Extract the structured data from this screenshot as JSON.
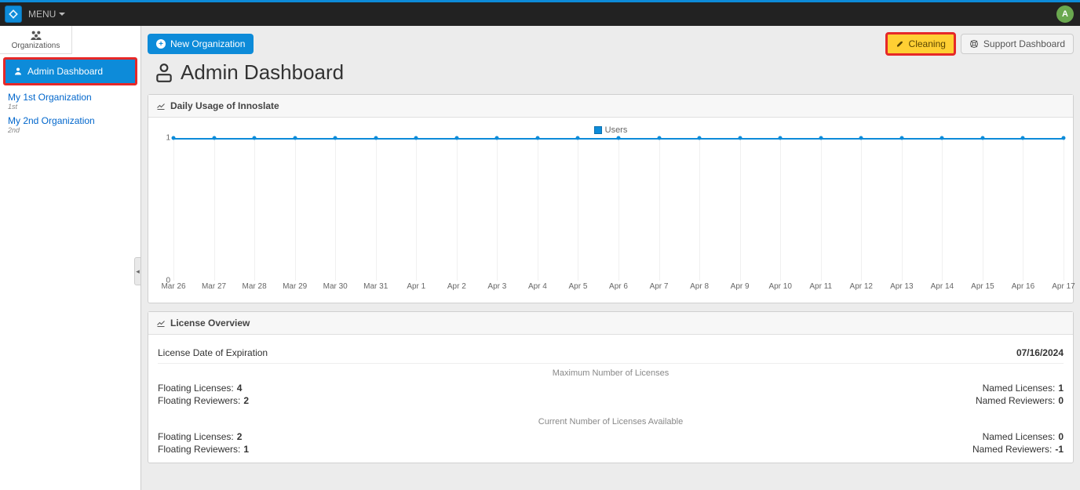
{
  "navbar": {
    "menu_label": "MENU",
    "avatar_initial": "A"
  },
  "sidebar": {
    "tab_label": "Organizations",
    "admin_label": "Admin Dashboard",
    "orgs": [
      {
        "name": "My 1st Organization",
        "sub": "1st"
      },
      {
        "name": "My 2nd Organization",
        "sub": "2nd"
      }
    ]
  },
  "toolbar": {
    "new_org_label": "New Organization",
    "cleaning_label": "Cleaning",
    "support_label": "Support Dashboard"
  },
  "page": {
    "title": "Admin Dashboard"
  },
  "usage_panel": {
    "title": "Daily Usage of Innoslate",
    "legend_label": "Users"
  },
  "license_panel": {
    "title": "License Overview",
    "expiration_label": "License Date of Expiration",
    "expiration_value": "07/16/2024",
    "max_note": "Maximum Number of Licenses",
    "avail_note": "Current Number of Licenses Available",
    "max": {
      "floating_licenses_label": "Floating Licenses:",
      "floating_licenses_value": "4",
      "floating_reviewers_label": "Floating Reviewers:",
      "floating_reviewers_value": "2",
      "named_licenses_label": "Named Licenses:",
      "named_licenses_value": "1",
      "named_reviewers_label": "Named Reviewers:",
      "named_reviewers_value": "0"
    },
    "avail": {
      "floating_licenses_label": "Floating Licenses:",
      "floating_licenses_value": "2",
      "floating_reviewers_label": "Floating Reviewers:",
      "floating_reviewers_value": "1",
      "named_licenses_label": "Named Licenses:",
      "named_licenses_value": "0",
      "named_reviewers_label": "Named Reviewers:",
      "named_reviewers_value": "-1"
    }
  },
  "chart_data": {
    "type": "line",
    "title": "Daily Usage of Innoslate",
    "xlabel": "",
    "ylabel": "",
    "ylim": [
      0,
      1
    ],
    "yticks": [
      0,
      1
    ],
    "categories": [
      "Mar 26",
      "Mar 27",
      "Mar 28",
      "Mar 29",
      "Mar 30",
      "Mar 31",
      "Apr 1",
      "Apr 2",
      "Apr 3",
      "Apr 4",
      "Apr 5",
      "Apr 6",
      "Apr 7",
      "Apr 8",
      "Apr 9",
      "Apr 10",
      "Apr 11",
      "Apr 12",
      "Apr 13",
      "Apr 14",
      "Apr 15",
      "Apr 16",
      "Apr 17"
    ],
    "series": [
      {
        "name": "Users",
        "values": [
          1,
          1,
          1,
          1,
          1,
          1,
          1,
          1,
          1,
          1,
          1,
          1,
          1,
          1,
          1,
          1,
          1,
          1,
          1,
          1,
          1,
          1,
          1
        ]
      }
    ]
  }
}
